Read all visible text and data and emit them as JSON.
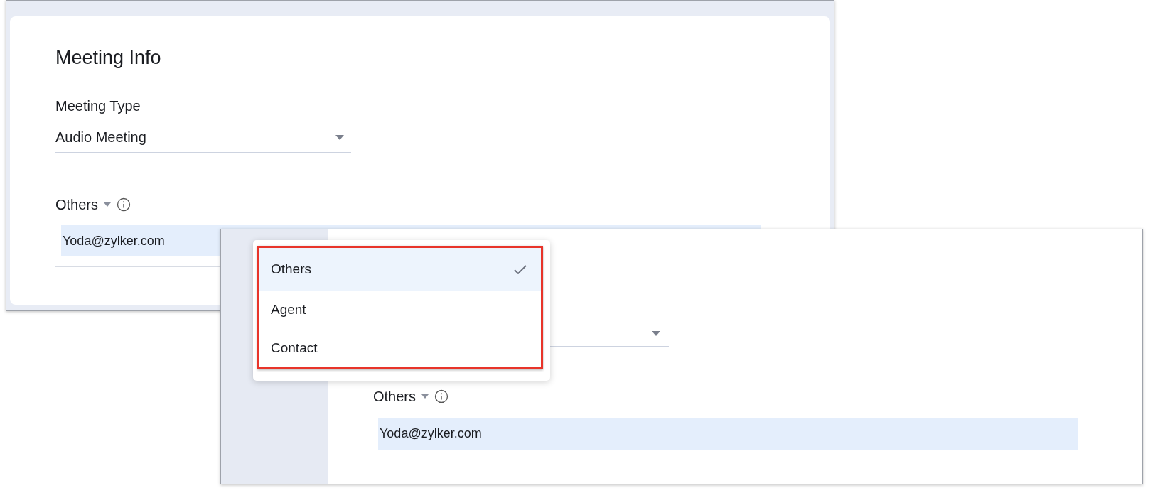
{
  "back_window": {
    "title": "Meeting Info",
    "meeting_type": {
      "label": "Meeting Type",
      "value": "Audio Meeting"
    },
    "recipients": {
      "label": "Others",
      "value": "Yoda@zylker.com"
    }
  },
  "front_window": {
    "recipients": {
      "label": "Others",
      "value": "Yoda@zylker.com"
    }
  },
  "dropdown": {
    "options": [
      {
        "label": "Others",
        "selected": true
      },
      {
        "label": "Agent",
        "selected": false
      },
      {
        "label": "Contact",
        "selected": false
      }
    ]
  }
}
